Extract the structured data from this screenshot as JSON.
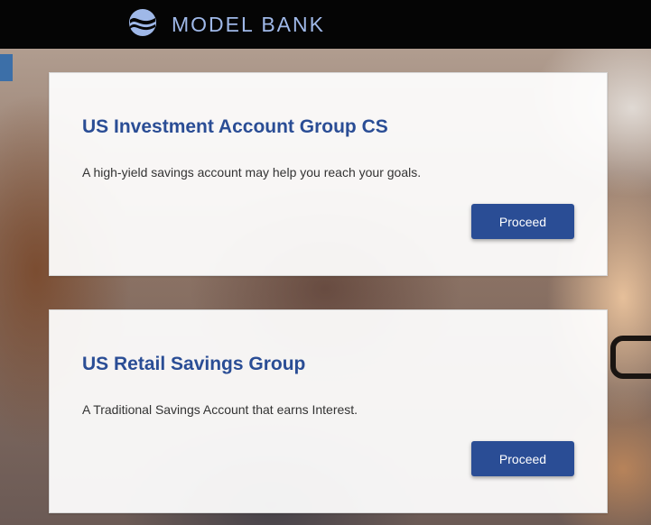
{
  "header": {
    "brand_name": "MODEL BANK",
    "logo_icon": "model-bank-logo"
  },
  "products": [
    {
      "title": "US Investment Account Group CS",
      "description": "A high-yield savings account may help you reach your goals.",
      "button_label": "Proceed"
    },
    {
      "title": "US Retail Savings Group",
      "description": "A Traditional Savings Account that earns Interest.",
      "button_label": "Proceed"
    }
  ],
  "colors": {
    "header_bg": "#050505",
    "brand_text": "#9fb8e8",
    "title_blue": "#2a4d95",
    "button_bg": "#2a4d95"
  }
}
